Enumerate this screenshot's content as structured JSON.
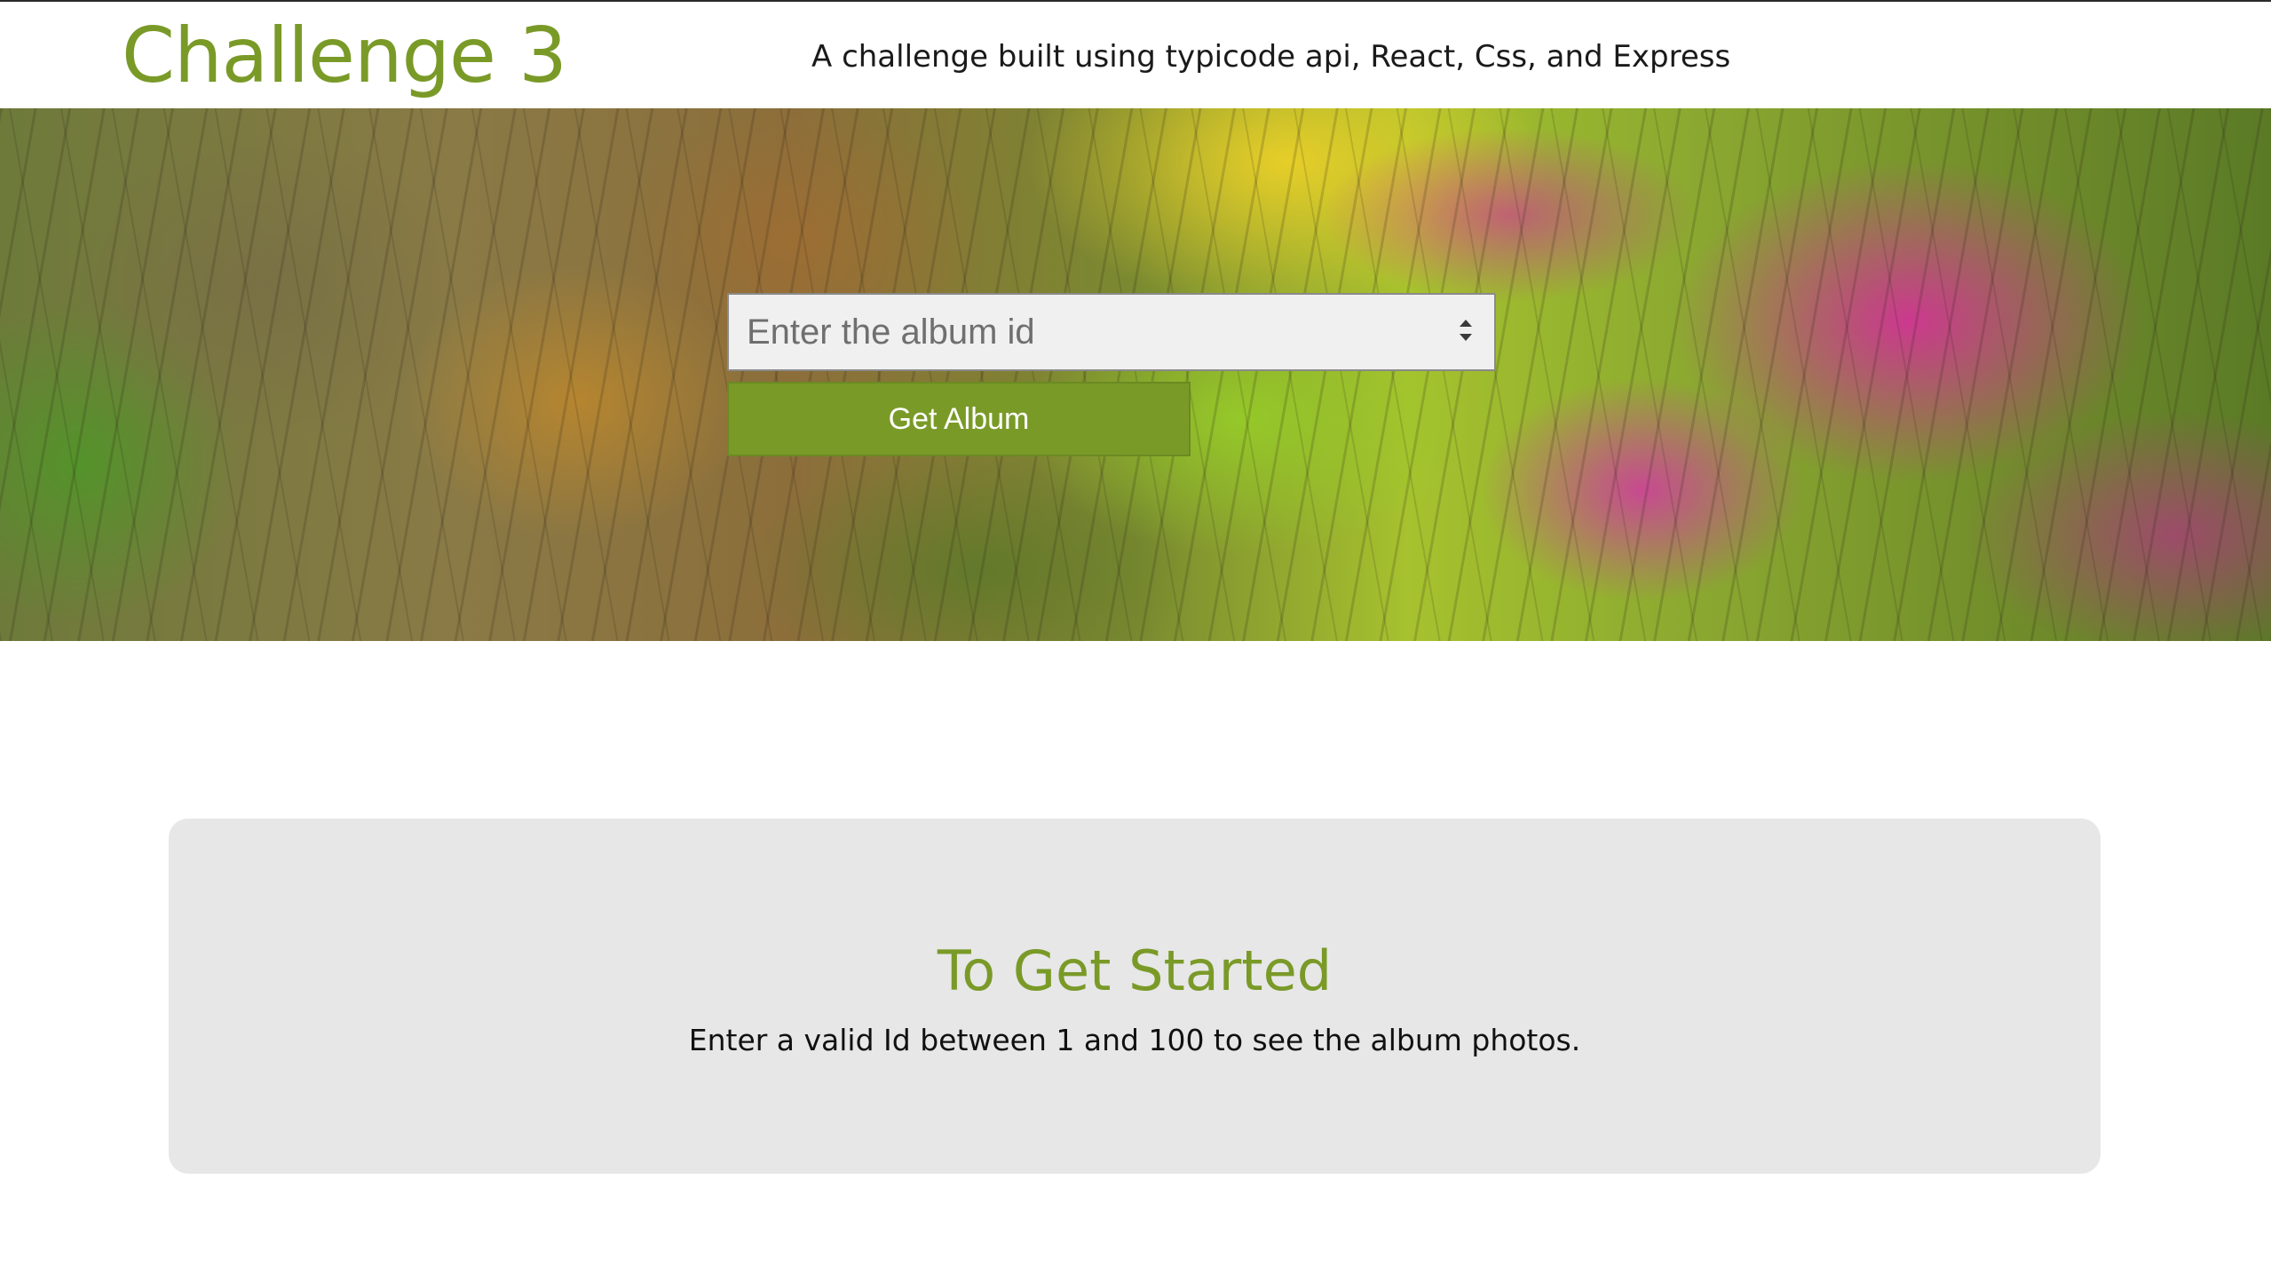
{
  "header": {
    "title": "Challenge 3",
    "subtitle": "A challenge built using typicode api, React, Css, and Express"
  },
  "search": {
    "placeholder": "Enter the album id",
    "value": "",
    "button_label": "Get Album"
  },
  "info_card": {
    "title": "To Get Started",
    "text": "Enter a valid Id between 1 and 100 to see the album photos."
  },
  "colors": {
    "accent": "#7a9a28",
    "card_background": "#e7e7e7",
    "input_background": "#f0f0f0"
  },
  "icons": {
    "spinner": "number-spinner-icon"
  }
}
